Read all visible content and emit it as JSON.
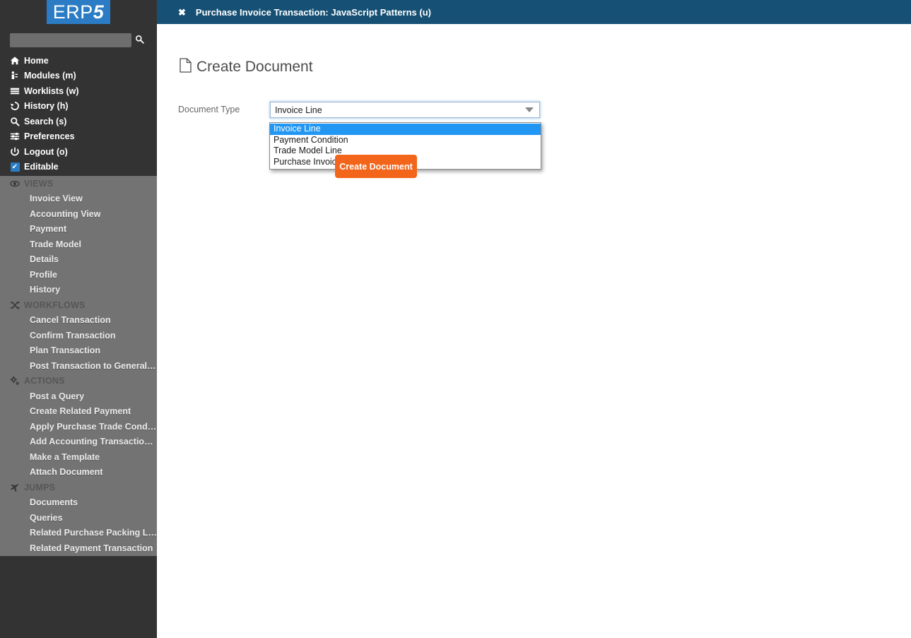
{
  "brand": {
    "logo_prefix": "ERP",
    "logo_suffix": "5"
  },
  "search": {
    "value": "",
    "placeholder": "",
    "icon": "search-icon"
  },
  "header": {
    "tab_close_label": "✖",
    "tab_title": "Purchase Invoice Transaction: JavaScript Patterns (u)"
  },
  "sidebar": {
    "main_items": [
      {
        "icon": "home-icon",
        "glyph": "⌂",
        "label": "Home"
      },
      {
        "icon": "modules-icon",
        "glyph": "⛁",
        "label": "Modules (m)"
      },
      {
        "icon": "worklists-icon",
        "glyph": "☰",
        "label": "Worklists (w)"
      },
      {
        "icon": "history-icon",
        "glyph": "↺",
        "label": "History (h)"
      },
      {
        "icon": "search-icon",
        "glyph": "⚲",
        "label": "Search (s)"
      },
      {
        "icon": "preferences-icon",
        "glyph": "☲",
        "label": "Preferences"
      },
      {
        "icon": "logout-icon",
        "glyph": "⏻",
        "label": "Logout (o)"
      },
      {
        "icon": "checkbox-checked-icon",
        "glyph": "✔",
        "label": "Editable"
      }
    ],
    "sections": [
      {
        "icon": "eye-icon",
        "title": "VIEWS",
        "items": [
          "Invoice View",
          "Accounting View",
          "Payment",
          "Trade Model",
          "Details",
          "Profile",
          "History"
        ]
      },
      {
        "icon": "shuffle-icon",
        "title": "WORKFLOWS",
        "items": [
          "Cancel Transaction",
          "Confirm Transaction",
          "Plan Transaction",
          "Post Transaction to General L…"
        ]
      },
      {
        "icon": "gears-icon",
        "title": "ACTIONS",
        "items": [
          "Post a Query",
          "Create Related Payment",
          "Apply Purchase Trade Conditi…",
          "Add Accounting Transaction L…",
          "Make a Template",
          "Attach Document"
        ]
      },
      {
        "icon": "airplane-icon",
        "title": "JUMPS",
        "items": [
          "Documents",
          "Queries",
          "Related Purchase Packing List",
          "Related Payment Transaction"
        ]
      }
    ]
  },
  "main": {
    "page_title": "Create Document",
    "page_title_icon": "document-icon",
    "form": {
      "document_type_label": "Document Type",
      "document_type_value": "Invoice Line",
      "document_type_options": [
        "Invoice Line",
        "Payment Condition",
        "Trade Model Line",
        "Purchase Invoice Transaction Line"
      ],
      "document_type_selected_index": 0
    },
    "create_button_label": "Create Document"
  },
  "colors": {
    "sidebar_dark": "#333333",
    "sidebar_gray": "#737373",
    "header_blue": "#165175",
    "logo_blue": "#2b7cc4",
    "accent_orange": "#f2651a",
    "highlight_blue": "#2196f3"
  }
}
